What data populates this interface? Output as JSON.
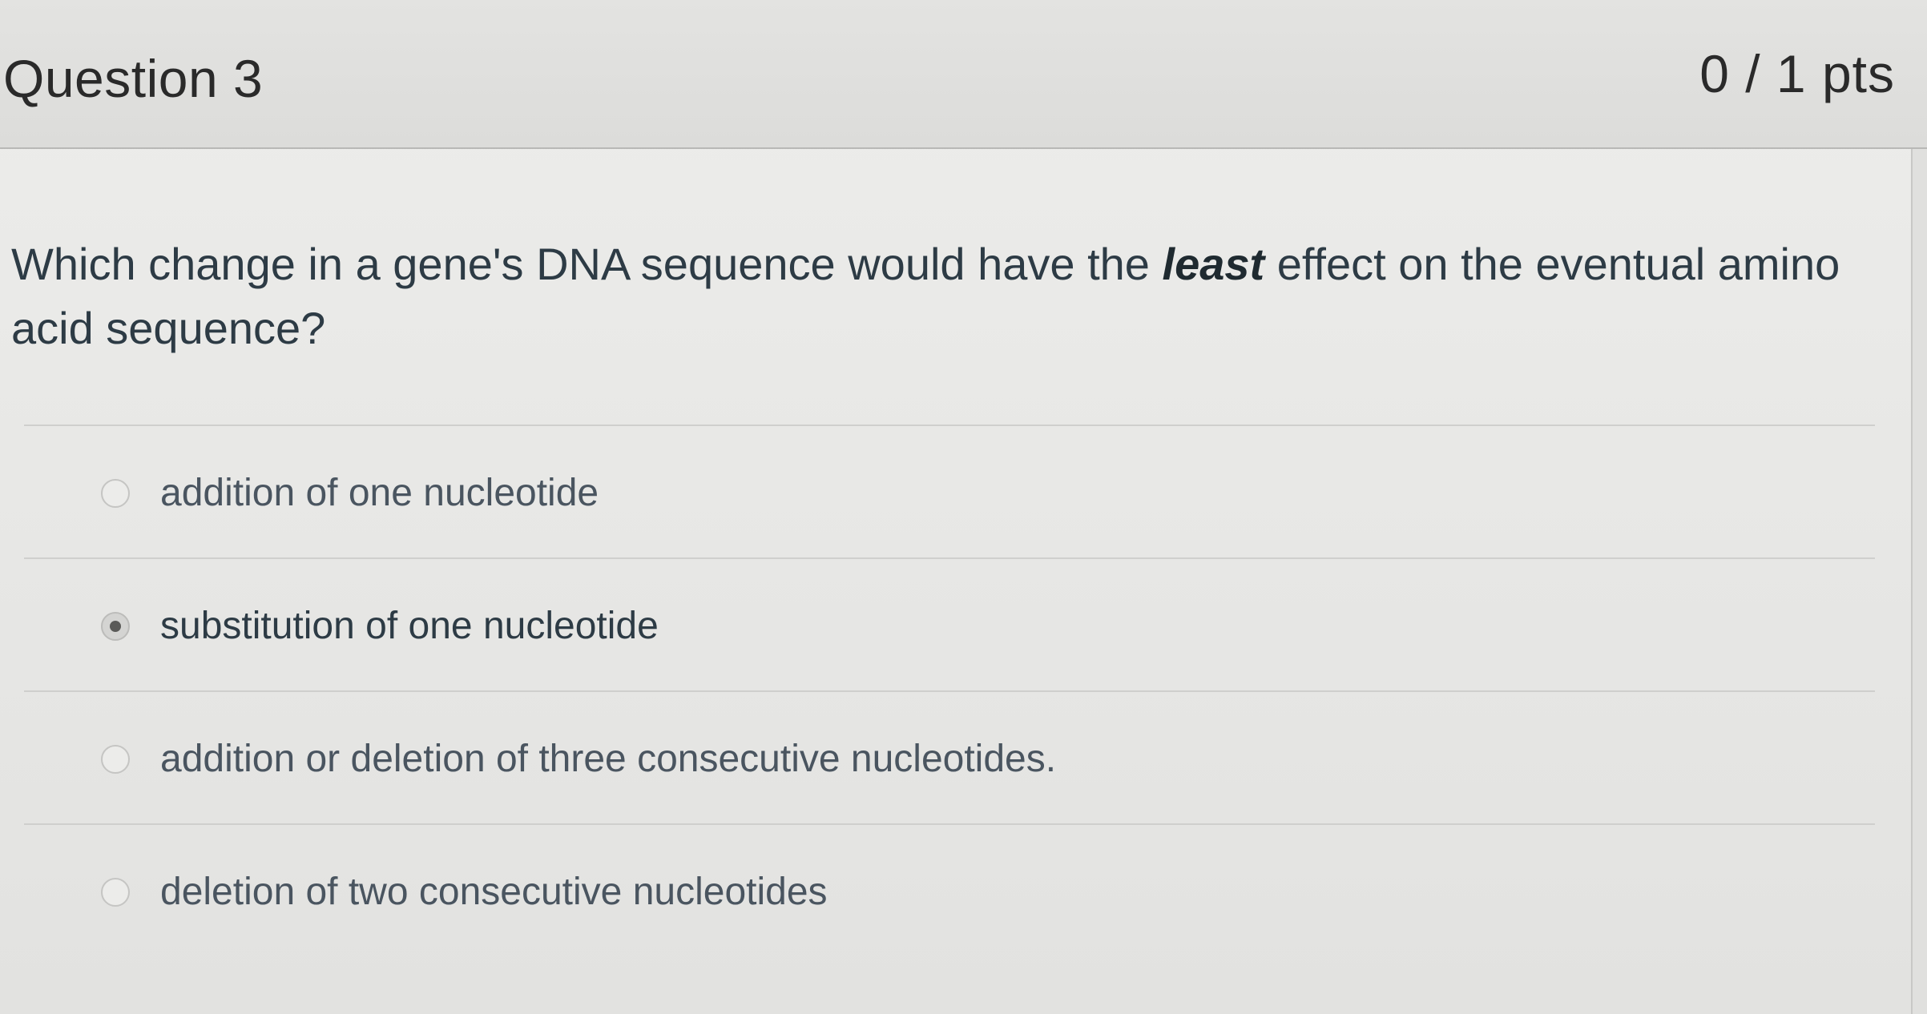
{
  "question": {
    "title": "Question 3",
    "points": "0 / 1 pts",
    "text_before": "Which change in a gene's DNA sequence would have the ",
    "text_emphasis": "least",
    "text_after": " effect on the eventual amino acid sequence?"
  },
  "answers": [
    {
      "label": "addition of one nucleotide",
      "selected": false
    },
    {
      "label": "substitution of one nucleotide",
      "selected": true
    },
    {
      "label": "addition or deletion of three consecutive nucleotides.",
      "selected": false
    },
    {
      "label": "deletion of two consecutive nucleotides",
      "selected": false
    }
  ]
}
